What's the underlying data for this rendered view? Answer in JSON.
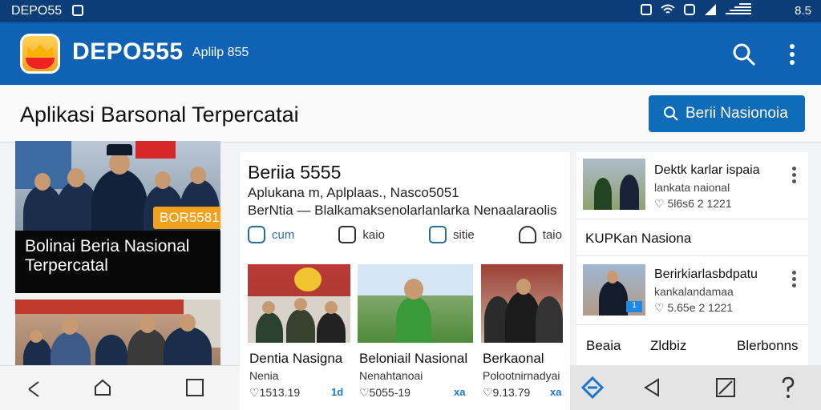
{
  "status_bar": {
    "title": "DEPO55",
    "time": "8.5",
    "icons": [
      "alarm-icon",
      "wifi-icon",
      "sync-icon",
      "signal-icon",
      "battery-icon"
    ]
  },
  "app_bar": {
    "name": "DEPO555",
    "subtitle": "Aplilp 855"
  },
  "heading": {
    "title": "Aplikasi Barsonal Terpercatai",
    "button_label": "Berii Nasionoia"
  },
  "hero": {
    "badge": "BOR5581",
    "caption": "Bolinai Beria Nasional Terpercatal"
  },
  "featured": {
    "title": "Beriia 5555",
    "line1": "Aplukana m, Aplplaas., Nasco5051",
    "line2": "BerNtia — Blalkamaksenolarlanlarka Nenaalaraolis",
    "tags": [
      "cum",
      "kaio",
      "sitie",
      "taio"
    ]
  },
  "thumbs": [
    {
      "title": "Dentia Nasigna",
      "sub": "Nenia",
      "meta": "♡1513.19",
      "tag": "1d"
    },
    {
      "title": "Beloniail Nasional",
      "sub": "Nenahtanoai",
      "meta": "♡5055-19",
      "tag": "xa"
    },
    {
      "title": "Berkaonal",
      "sub": "Polootnirnadyai",
      "meta": "♡9.13.79",
      "tag": "xa"
    }
  ],
  "side": [
    {
      "title": "Dektk karlar ispaia",
      "sub": "lankata naional",
      "meta": "♡ 5l6s6 2 1221"
    },
    {
      "title": "KUPKan Nasiona"
    },
    {
      "title": "Berirkiarlasbdpatu",
      "sub": "kankalandamaa",
      "meta": "♡ 5.65e 2 1221",
      "badge": "1"
    },
    {
      "title": "Beaia",
      "sub2": "Zldbiz",
      "sub3": "Blerbonns"
    }
  ],
  "colors": {
    "status_bar": "#0b3e78",
    "app_bar": "#0f62b4",
    "button": "#0f6cb8",
    "badge": "#f2a11b"
  }
}
